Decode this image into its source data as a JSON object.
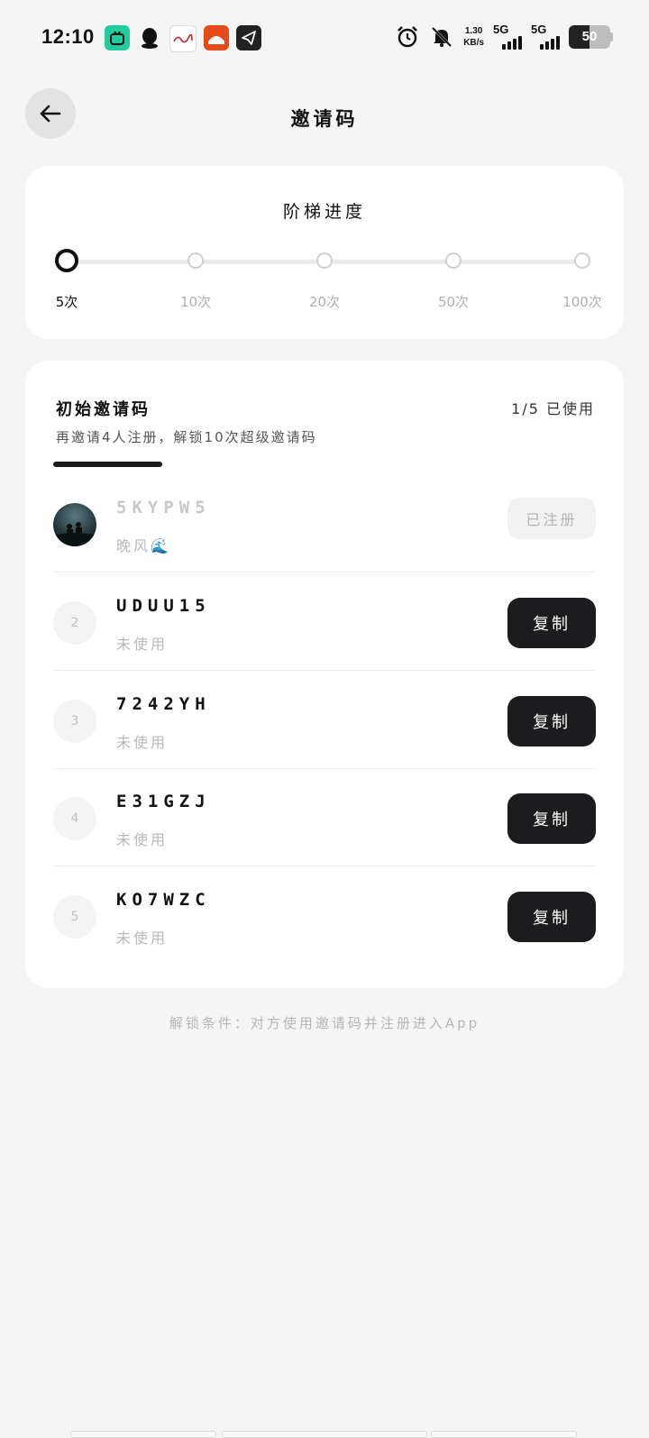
{
  "status_bar": {
    "time": "12:10",
    "app_icons": [
      "bilibili-icon",
      "qq-icon",
      "peoples-daily-icon",
      "news-app-icon",
      "telegram-icon"
    ],
    "net_speed_value": "1.30",
    "net_speed_unit": "KB/s",
    "signal_1_label": "5G",
    "signal_2_label": "5G",
    "battery_level": "50",
    "battery_fraction": 0.5
  },
  "header": {
    "title": "邀请码"
  },
  "ladder": {
    "title": "阶梯进度",
    "tiers": [
      {
        "label": "5次",
        "active": true
      },
      {
        "label": "10次",
        "active": false
      },
      {
        "label": "20次",
        "active": false
      },
      {
        "label": "50次",
        "active": false
      },
      {
        "label": "100次",
        "active": false
      }
    ]
  },
  "codes": {
    "title": "初始邀请码",
    "used_count": "1/5 已使用",
    "description": "再邀请4人注册，解锁10次超级邀请码",
    "items": [
      {
        "index": "",
        "code": "5KYPW5",
        "status": "晚风🌊",
        "button": "已注册",
        "used": true
      },
      {
        "index": "2",
        "code": "UDUU15",
        "status": "未使用",
        "button": "复制",
        "used": false
      },
      {
        "index": "3",
        "code": "7242YH",
        "status": "未使用",
        "button": "复制",
        "used": false
      },
      {
        "index": "4",
        "code": "E31GZJ",
        "status": "未使用",
        "button": "复制",
        "used": false
      },
      {
        "index": "5",
        "code": "KO7WZC",
        "status": "未使用",
        "button": "复制",
        "used": false
      }
    ]
  },
  "footer": {
    "note": "解锁条件：对方使用邀请码并注册进入App"
  },
  "colors": {
    "background": "#f5f5f5",
    "card": "#ffffff",
    "primary_button": "#1c1c1e",
    "muted_text": "#b5b5b5"
  }
}
